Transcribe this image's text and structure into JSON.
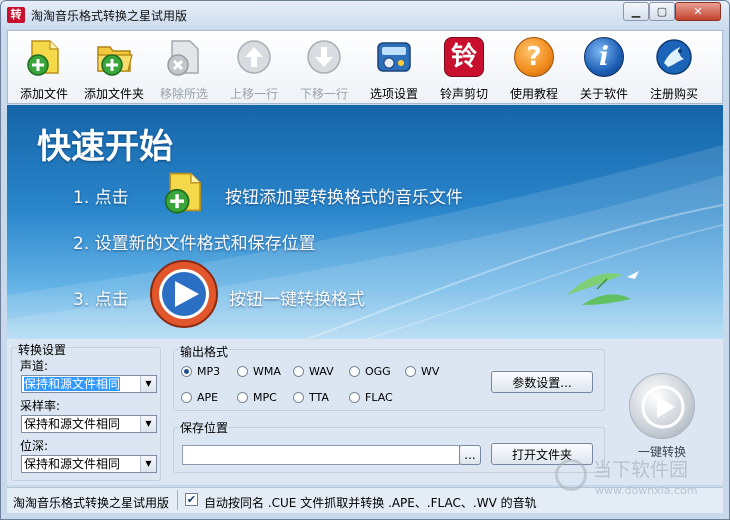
{
  "window": {
    "title": "淘淘音乐格式转换之星试用版",
    "app_icon_char": "转"
  },
  "toolbar": {
    "items": [
      {
        "label": "添加文件",
        "icon": "add-file-icon",
        "enabled": true
      },
      {
        "label": "添加文件夹",
        "icon": "add-folder-icon",
        "enabled": true
      },
      {
        "label": "移除所选",
        "icon": "remove-selected-icon",
        "enabled": false
      },
      {
        "label": "上移一行",
        "icon": "move-up-icon",
        "enabled": false
      },
      {
        "label": "下移一行",
        "icon": "move-down-icon",
        "enabled": false
      },
      {
        "label": "选项设置",
        "icon": "options-icon",
        "enabled": true
      },
      {
        "label": "铃声剪切",
        "icon": "ringtone-cut-icon",
        "icon_char": "铃",
        "enabled": true
      },
      {
        "label": "使用教程",
        "icon": "help-icon",
        "icon_char": "?",
        "enabled": true
      },
      {
        "label": "关于软件",
        "icon": "about-icon",
        "icon_char": "i",
        "enabled": true
      },
      {
        "label": "注册购买",
        "icon": "register-icon",
        "enabled": true
      }
    ]
  },
  "banner": {
    "title": "快速开始",
    "step1_prefix": "1. 点击",
    "step1_suffix": "按钮添加要转换格式的音乐文件",
    "step2": "2. 设置新的文件格式和保存位置",
    "step3_prefix": "3. 点击",
    "step3_suffix": "按钮一键转换格式"
  },
  "convert_settings": {
    "legend": "转换设置",
    "channel_label": "声道:",
    "channel_value": "保持和源文件相同",
    "samplerate_label": "采样率:",
    "samplerate_value": "保持和源文件相同",
    "bitdepth_label": "位深:",
    "bitdepth_value": "保持和源文件相同"
  },
  "output_format": {
    "legend": "输出格式",
    "formats": [
      "MP3",
      "WMA",
      "WAV",
      "OGG",
      "WV",
      "APE",
      "MPC",
      "TTA",
      "FLAC"
    ],
    "selected": "MP3",
    "params_button": "参数设置..."
  },
  "save_location": {
    "legend": "保存位置",
    "path_value": "",
    "browse_button": "...",
    "open_folder_button": "打开文件夹"
  },
  "convert": {
    "label": "一键转换"
  },
  "statusbar": {
    "left_text": "淘淘音乐格式转换之星试用版",
    "auto_cue_checked": true,
    "auto_cue_label": "自动按同名 .CUE 文件抓取并转换 .APE、.FLAC、.WV 的音轨"
  },
  "watermark": {
    "text": "当下软件园",
    "url": "www.downxia.com"
  },
  "colors": {
    "banner_top": "#1565a8",
    "banner_bottom": "#a9d6f2",
    "close_button": "#c4412c",
    "ringtone_red": "#c8102e",
    "help_orange": "#f08a1c",
    "about_blue": "#1d5fb5"
  }
}
